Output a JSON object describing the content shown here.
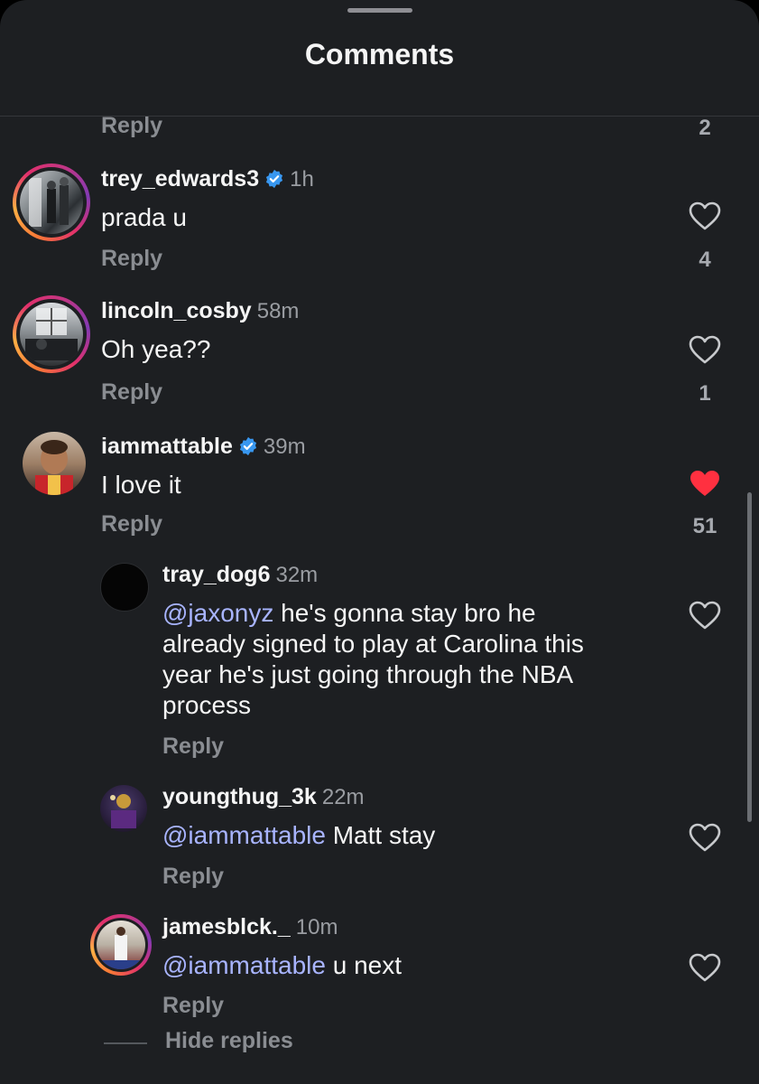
{
  "sheet": {
    "title": "Comments"
  },
  "top_reply": {
    "label": "Reply",
    "likes": "2"
  },
  "comments": [
    {
      "username": "trey_edwards3",
      "verified": true,
      "time": "1h",
      "text": "prada u",
      "reply": "Reply",
      "likes": "4",
      "liked": false
    },
    {
      "username": "lincoln_cosby",
      "verified": false,
      "time": "58m",
      "text": "Oh yea??",
      "reply": "Reply",
      "likes": "1",
      "liked": false
    },
    {
      "username": "iammattable",
      "verified": true,
      "time": "39m",
      "text": "I love it",
      "reply": "Reply",
      "likes": "51",
      "liked": true
    }
  ],
  "replies": [
    {
      "username": "tray_dog6",
      "time": "32m",
      "mention": "@jaxonyz",
      "lines": [
        " he's gonna stay bro he",
        "already signed to play at Carolina this",
        "year he's just going through the NBA",
        "process"
      ],
      "reply": "Reply"
    },
    {
      "username": "youngthug_3k",
      "time": "22m",
      "mention": "@iammattable",
      "text": " Matt stay",
      "reply": "Reply"
    },
    {
      "username": "jamesblck._",
      "time": "10m",
      "mention": "@iammattable",
      "text": " u next",
      "reply": "Reply"
    }
  ],
  "hide_replies": "Hide replies",
  "colors": {
    "background": "#1d1f22",
    "mention": "#a8b4ff",
    "liked_heart": "#ff3040",
    "verified": "#3897f0"
  },
  "icons": {
    "like": "heart-outline-icon",
    "liked": "heart-filled-icon",
    "verified": "verified-badge-icon"
  }
}
